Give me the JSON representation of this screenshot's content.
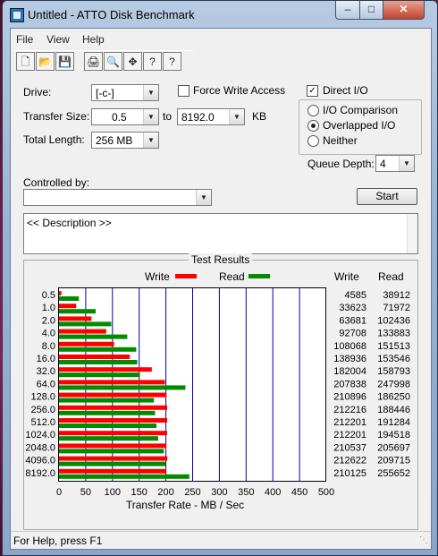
{
  "window": {
    "title": "Untitled - ATTO Disk Benchmark"
  },
  "menu": [
    "File",
    "View",
    "Help"
  ],
  "toolbar": {
    "icons": [
      "new-icon",
      "open-icon",
      "save-icon",
      "print-icon",
      "print-preview-icon",
      "move-icon",
      "help-icon",
      "context-help-icon"
    ]
  },
  "drive": {
    "label": "Drive:",
    "value": "[-c-]"
  },
  "force_write": {
    "label": "Force Write Access",
    "checked": false
  },
  "direct_io": {
    "label": "Direct I/O",
    "checked": true
  },
  "transfer": {
    "label": "Transfer Size:",
    "from": "0.5",
    "to_label": "to",
    "to": "8192.0",
    "unit": "KB"
  },
  "total_length": {
    "label": "Total Length:",
    "value": "256 MB"
  },
  "io_mode": {
    "options": [
      "I/O Comparison",
      "Overlapped I/O",
      "Neither"
    ],
    "selected": "Overlapped I/O"
  },
  "queue_depth": {
    "label": "Queue Depth:",
    "value": "4"
  },
  "controlled_by": {
    "label": "Controlled by:",
    "value": ""
  },
  "start_button": "Start",
  "description": "<< Description >>",
  "results": {
    "title": "Test Results",
    "legend_write": "Write",
    "legend_read": "Read",
    "col_write": "Write",
    "col_read": "Read",
    "write_values": [
      "4585",
      "33623",
      "63681",
      "92708",
      "108068",
      "138936",
      "182004",
      "207838",
      "210896",
      "212216",
      "212201",
      "212201",
      "210537",
      "212622",
      "210125"
    ],
    "read_values": [
      "38912",
      "71972",
      "102436",
      "133883",
      "151513",
      "153546",
      "158793",
      "247998",
      "186250",
      "188446",
      "191284",
      "194518",
      "205697",
      "209715",
      "255652"
    ]
  },
  "status": "For Help, press F1",
  "colors": {
    "write": "#ff0000",
    "read": "#008c00",
    "grid": "#0000aa"
  },
  "chart_data": {
    "type": "bar",
    "categories": [
      "0.5",
      "1.0",
      "2.0",
      "4.0",
      "8.0",
      "16.0",
      "32.0",
      "64.0",
      "128.0",
      "256.0",
      "512.0",
      "1024.0",
      "2048.0",
      "4096.0",
      "8192.0"
    ],
    "series": [
      {
        "name": "Write",
        "values": [
          4.4,
          32.1,
          60.7,
          88.4,
          103.1,
          132.5,
          173.6,
          198.2,
          201.1,
          202.4,
          202.4,
          202.4,
          200.8,
          202.8,
          200.4
        ]
      },
      {
        "name": "Read",
        "values": [
          37.1,
          68.6,
          97.7,
          127.7,
          144.5,
          146.4,
          151.4,
          236.5,
          177.6,
          179.7,
          182.4,
          185.5,
          196.2,
          200.0,
          243.8
        ]
      }
    ],
    "xlabel": "Transfer Rate - MB / Sec",
    "xticks": [
      "0",
      "50",
      "100",
      "150",
      "200",
      "250",
      "300",
      "350",
      "400",
      "450",
      "500"
    ],
    "xlim": [
      0,
      500
    ],
    "grid": true,
    "legend": "top"
  }
}
